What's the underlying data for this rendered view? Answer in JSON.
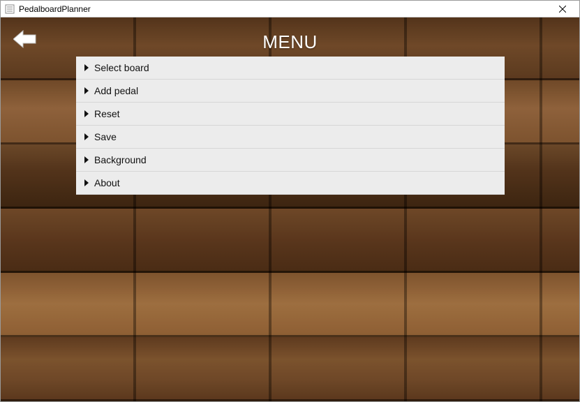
{
  "window": {
    "title": "PedalboardPlanner"
  },
  "header": {
    "title": "MENU"
  },
  "menu": {
    "items": [
      {
        "label": "Select board"
      },
      {
        "label": "Add pedal"
      },
      {
        "label": "Reset"
      },
      {
        "label": "Save"
      },
      {
        "label": "Background"
      },
      {
        "label": "About"
      }
    ]
  }
}
